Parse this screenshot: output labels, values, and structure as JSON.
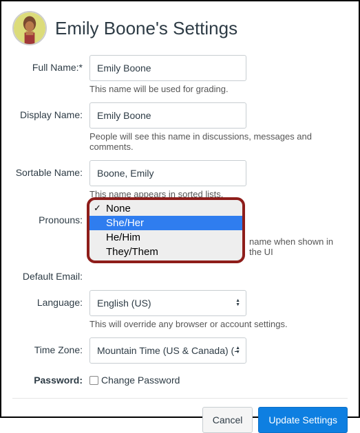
{
  "header": {
    "title": "Emily Boone's Settings"
  },
  "fields": {
    "full_name": {
      "label": "Full Name:*",
      "value": "Emily Boone",
      "hint": "This name will be used for grading."
    },
    "display_name": {
      "label": "Display Name:",
      "value": "Emily Boone",
      "hint": "People will see this name in discussions, messages and comments."
    },
    "sortable_name": {
      "label": "Sortable Name:",
      "value": "Boone, Emily",
      "hint": "This name appears in sorted lists."
    },
    "pronouns": {
      "label": "Pronouns:",
      "hint_visible_fragment": "name when shown in the UI",
      "options": [
        "None",
        "She/Her",
        "He/Him",
        "They/Them"
      ],
      "selected": "None",
      "highlighted": "She/Her"
    },
    "default_email": {
      "label": "Default Email:"
    },
    "language": {
      "label": "Language:",
      "value": "English (US)",
      "hint": "This will override any browser or account settings."
    },
    "time_zone": {
      "label": "Time Zone:",
      "value": "Mountain Time (US & Canada) (-"
    },
    "password": {
      "label": "Password:",
      "checkbox_label": "Change Password"
    }
  },
  "footer": {
    "cancel": "Cancel",
    "update": "Update Settings"
  }
}
